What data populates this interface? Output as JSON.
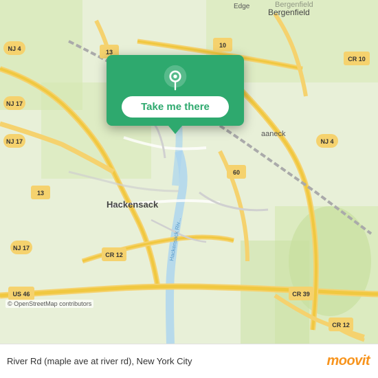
{
  "map": {
    "attribution": "© OpenStreetMap contributors",
    "background_color": "#e8f0d8"
  },
  "popup": {
    "take_me_there_label": "Take me there",
    "pin_color": "#ffffff"
  },
  "bottom_bar": {
    "location_text": "River Rd (maple ave at river rd), New York City",
    "moovit_label": "moovit"
  }
}
